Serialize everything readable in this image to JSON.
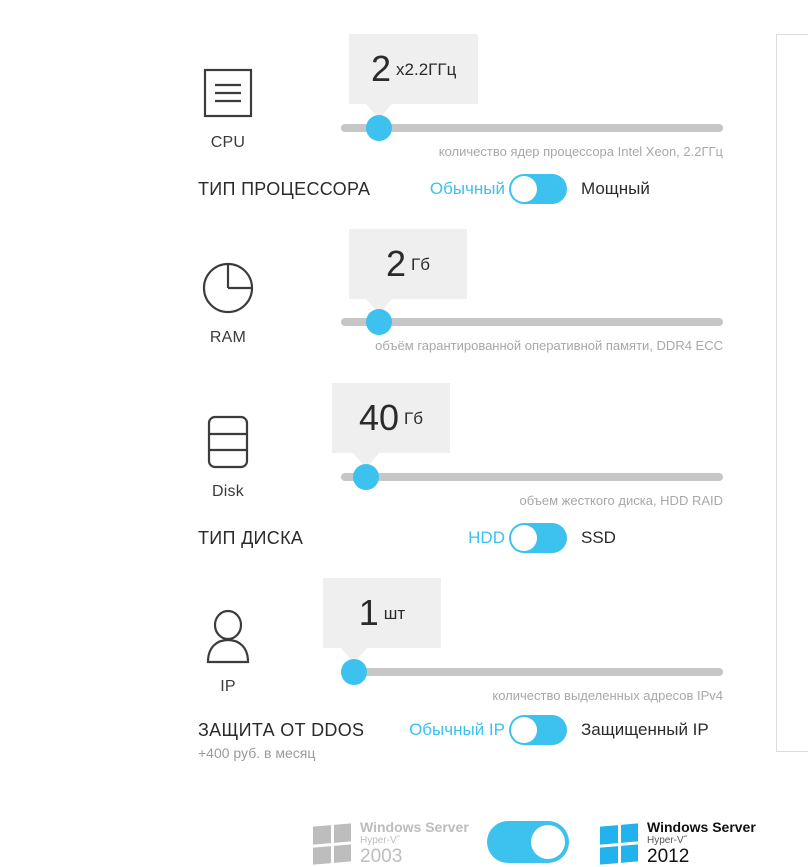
{
  "specs": [
    {
      "icon": "cpu-icon",
      "caption": "CPU",
      "value": "2",
      "unit": "x2.2ГГц",
      "hint": "количество ядер процессора Intel Xeon, 2.2ГГц",
      "knob_percent": 10
    },
    {
      "icon": "ram-icon",
      "caption": "RAM",
      "value": "2",
      "unit": "Гб",
      "hint": "объём гарантированной оперативной памяти, DDR4 ECC",
      "knob_percent": 10
    },
    {
      "icon": "disk-icon",
      "caption": "Disk",
      "value": "40",
      "unit": "Гб",
      "hint": "объем жесткого диска, HDD RAID",
      "knob_percent": 6
    },
    {
      "icon": "ip-icon",
      "caption": "IP",
      "value": "1",
      "unit": "шт",
      "hint": "количество выделенных адресов IPv4",
      "knob_percent": 0
    }
  ],
  "options": [
    {
      "title": "ТИП ПРОЦЕССОРА",
      "subtitle": "",
      "left_label": "Обычный",
      "right_label": "Мощный",
      "selected": "left"
    },
    {
      "title": "ТИП ДИСКА",
      "subtitle": "",
      "left_label": "HDD",
      "right_label": "SSD",
      "selected": "left"
    },
    {
      "title": "ЗАЩИТА ОТ DDOS",
      "subtitle": "+400 руб. в месяц",
      "left_label": "Обычный IP",
      "right_label": "Защищенный IP",
      "selected": "left"
    }
  ],
  "os_selector": {
    "left": {
      "name": "Windows Server",
      "hyperv": "Hyper-V˝",
      "year": "2003"
    },
    "right": {
      "name": "Windows Server",
      "hyperv": "Hyper-V˝",
      "year": "2012"
    },
    "selected": "right"
  },
  "colors": {
    "accent": "#3dc1ee",
    "track": "#c6c6c6",
    "bubble": "#efefef",
    "hint_text": "#a8a8a8",
    "body_text": "#2b2b2b",
    "muted_logo": "#bdbdbd",
    "windows_blue": "#22b3ef"
  }
}
